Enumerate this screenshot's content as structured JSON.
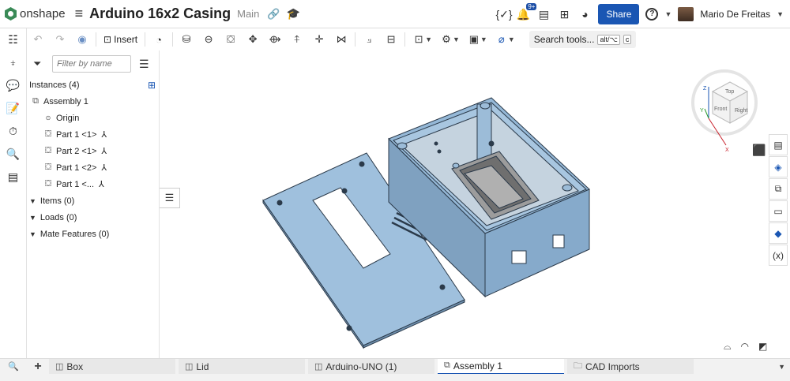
{
  "app": {
    "name": "onshape"
  },
  "document": {
    "title": "Arduino 16x2 Casing",
    "branch": "Main"
  },
  "header": {
    "notification_badge": "9+",
    "share_label": "Share",
    "help_icon": "?",
    "user_name": "Mario De Freitas"
  },
  "toolbar": {
    "insert_label": "Insert",
    "search_label": "Search tools...",
    "shortcut_1": "alt/⌥",
    "shortcut_2": "c"
  },
  "panel": {
    "filter_placeholder": "Filter by name",
    "instances_label": "Instances (4)",
    "tree": [
      {
        "label": "Assembly 1",
        "icon": "assembly-icon"
      },
      {
        "label": "Origin",
        "icon": "origin-icon"
      },
      {
        "label": "Part 1 <1>",
        "icon": "part-icon"
      },
      {
        "label": "Part 2 <1>",
        "icon": "part-icon"
      },
      {
        "label": "Part 1 <2>",
        "icon": "part-icon"
      },
      {
        "label": "Part 1 <...",
        "icon": "part-icon"
      }
    ],
    "sections": [
      {
        "label": "Items (0)"
      },
      {
        "label": "Loads (0)"
      },
      {
        "label": "Mate Features (0)"
      }
    ]
  },
  "view_cube": {
    "top": "Top",
    "front": "Front",
    "right": "Right",
    "axes": [
      "X",
      "Y",
      "Z"
    ]
  },
  "tabs": [
    {
      "label": "Box",
      "icon": "part-studio-icon",
      "active": false
    },
    {
      "label": "Lid",
      "icon": "part-studio-icon",
      "active": false
    },
    {
      "label": "Arduino-UNO (1)",
      "icon": "part-studio-icon",
      "active": false
    },
    {
      "label": "Assembly 1",
      "icon": "assembly-icon",
      "active": true
    },
    {
      "label": "CAD Imports",
      "icon": "folder-icon",
      "active": false
    }
  ],
  "colors": {
    "accent": "#1a56b3",
    "model_blue": "#8fb3d4",
    "model_edge": "#2b3a4a"
  }
}
